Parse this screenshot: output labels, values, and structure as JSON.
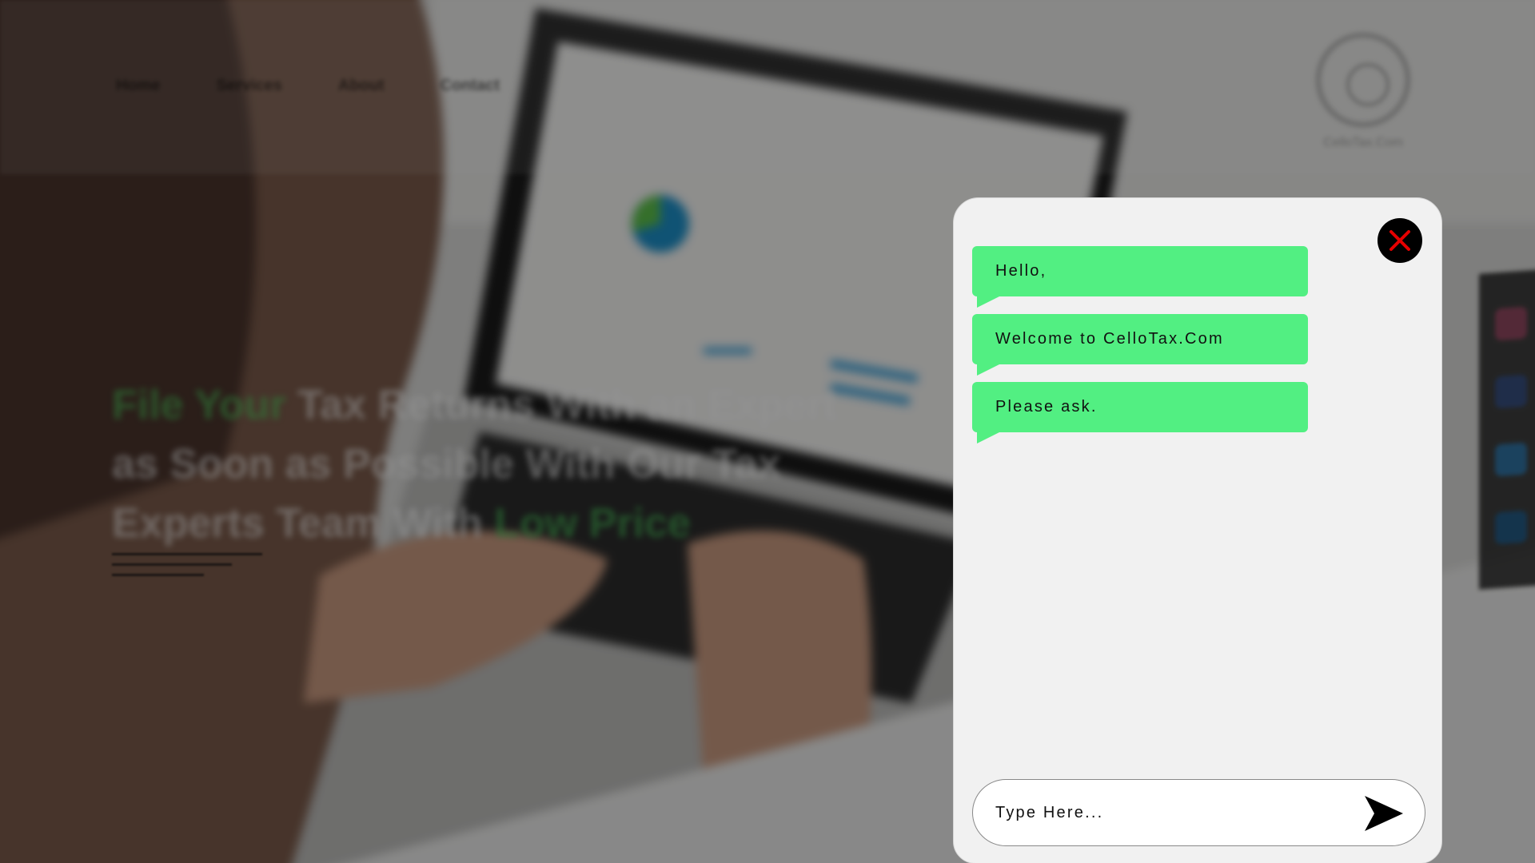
{
  "background": {
    "nav": [
      "Home",
      "Services",
      "About",
      "Contact"
    ],
    "brand_name": "CelloTax.Com",
    "hero": {
      "line1_accent": "File Your",
      "line1_rest": " Tax Returns With an Expert",
      "line2": "as Soon as Possible With Our Tax",
      "line3_rest": "Experts Team With ",
      "line3_accent": "Low Price"
    }
  },
  "chat": {
    "messages": [
      {
        "text": "Hello,"
      },
      {
        "text": "Welcome to CelloTax.Com"
      },
      {
        "text": "Please ask."
      }
    ],
    "input": {
      "placeholder": "Type Here...",
      "value": ""
    },
    "icons": {
      "close": "close-icon",
      "send": "send-icon"
    },
    "colors": {
      "bubble": "#52ef82",
      "close_x": "#e60000",
      "panel": "#f1f1f1"
    }
  }
}
